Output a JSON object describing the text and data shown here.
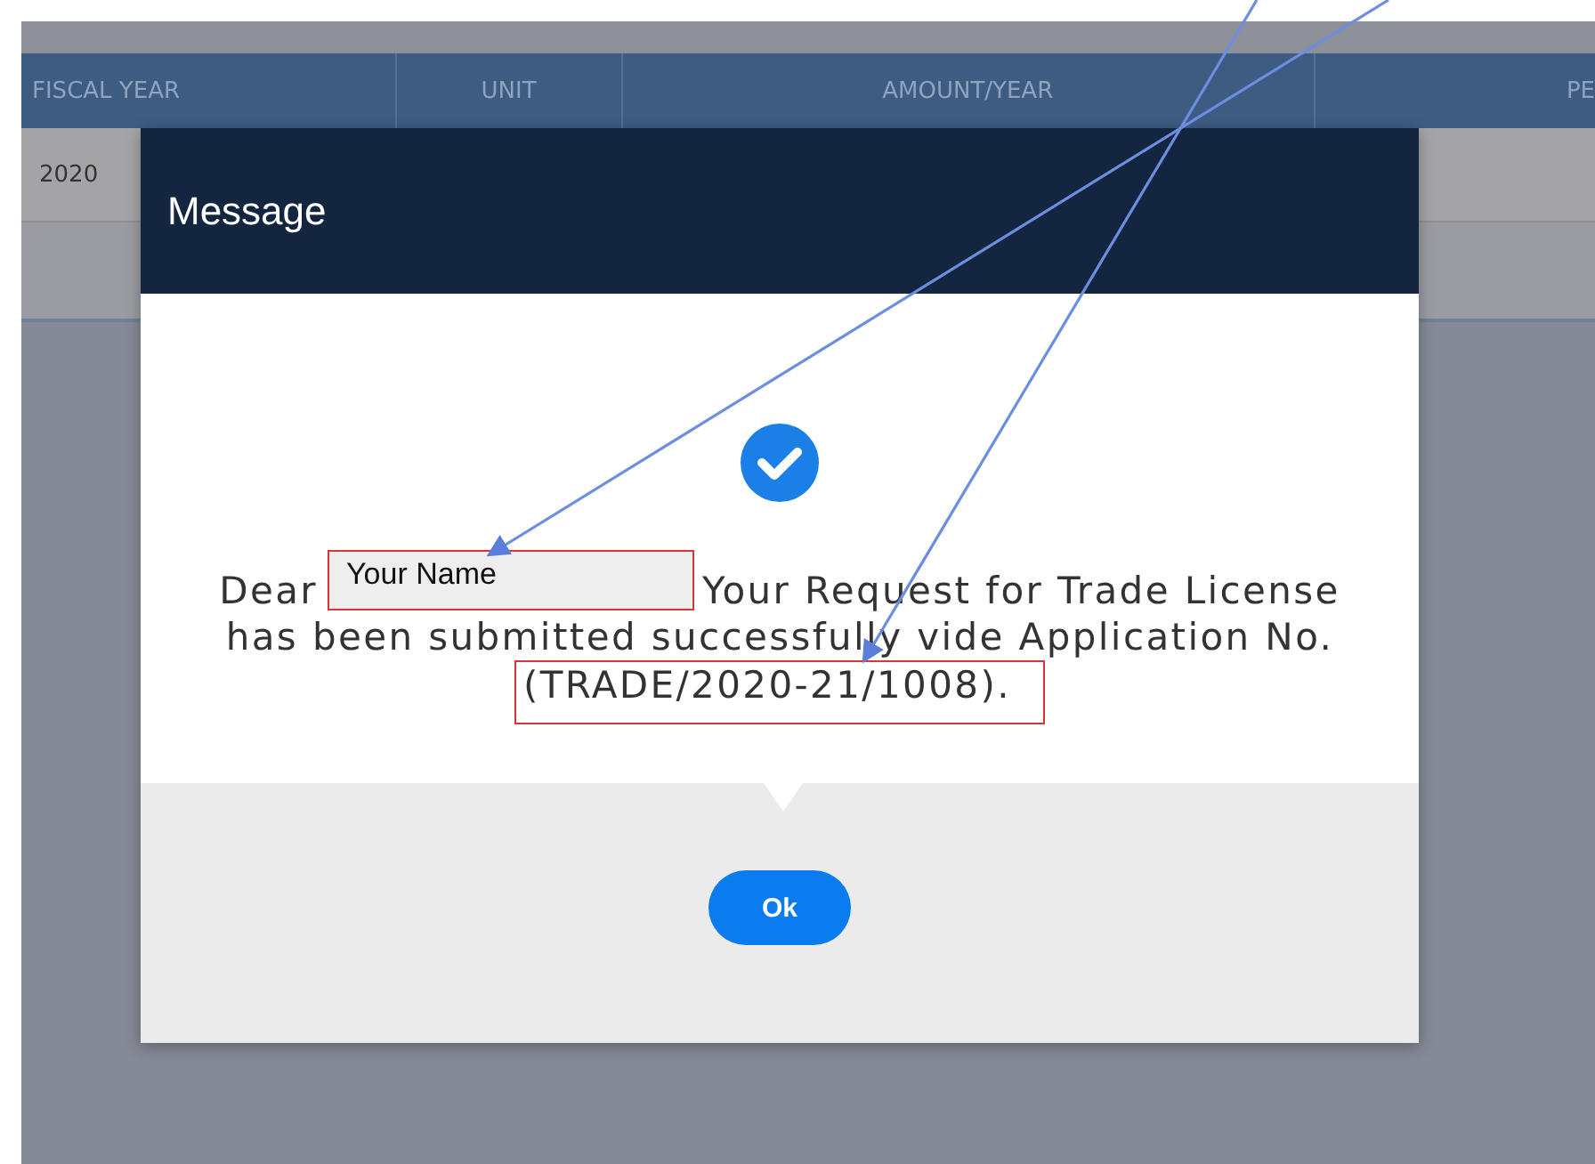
{
  "table": {
    "columns": [
      "FISCAL YEAR",
      "UNIT",
      "AMOUNT/YEAR",
      "PE"
    ],
    "rows": [
      [
        "2020"
      ]
    ]
  },
  "dialog": {
    "title": "Message",
    "message": {
      "greeting": "Dear",
      "name": "Your Name",
      "body_lines": [
        "Your Request for Trade License",
        "has been submitted successfully vide Application No."
      ],
      "application_no": "(TRADE/2020-21/1008)."
    },
    "button": "Ok"
  }
}
